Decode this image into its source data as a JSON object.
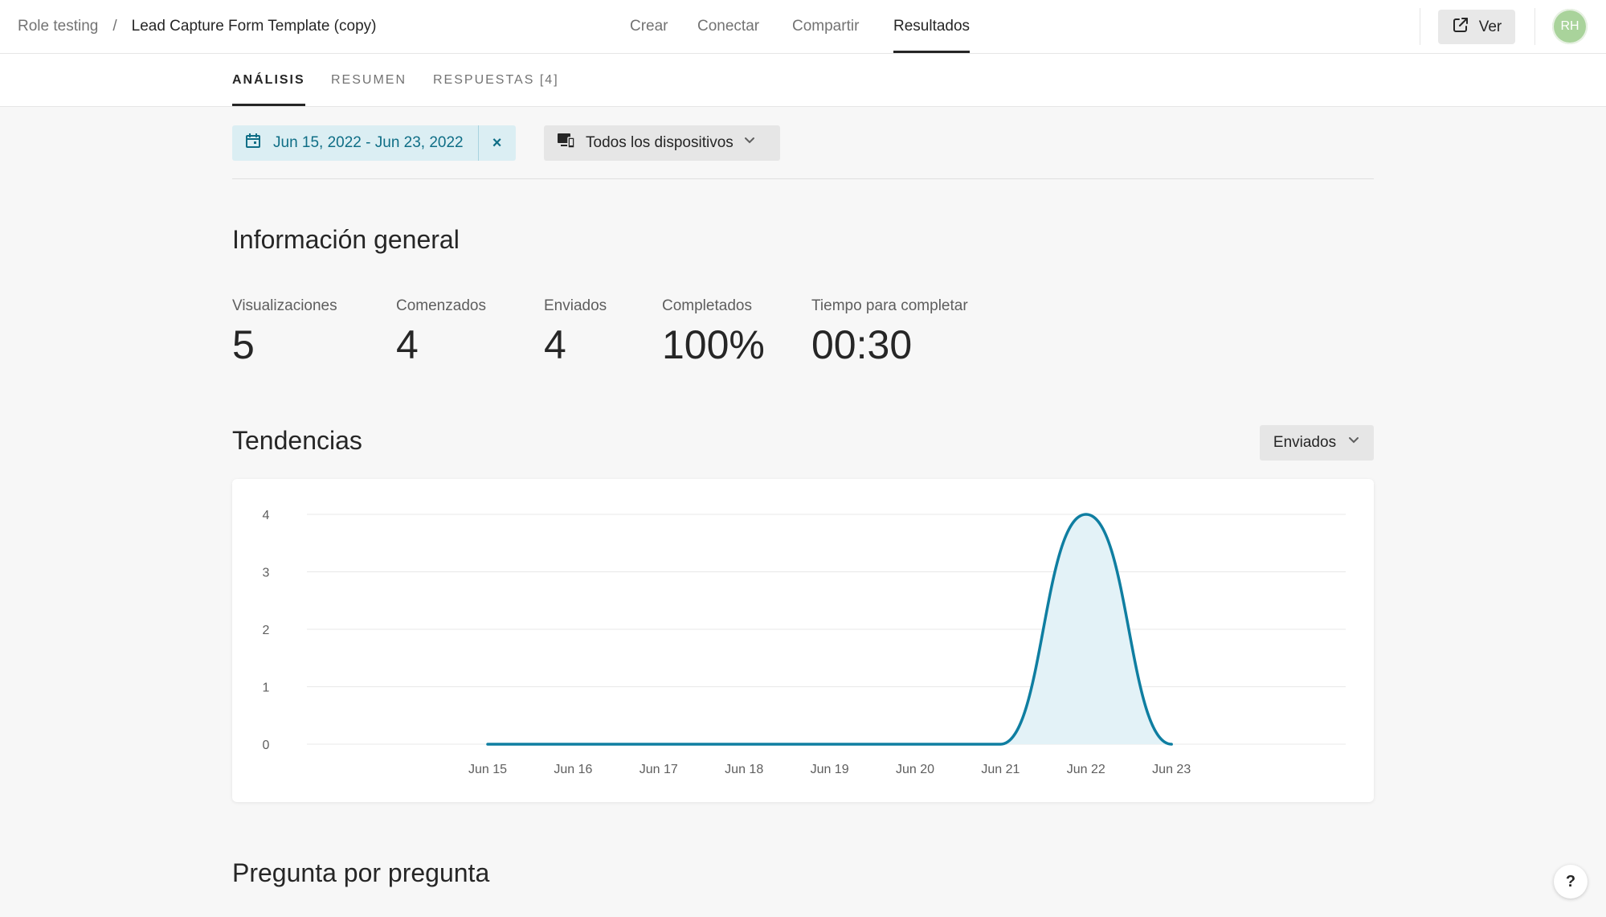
{
  "breadcrumb": {
    "workspace": "Role testing",
    "separator": "/",
    "form": "Lead Capture Form Template (copy)"
  },
  "top_nav": {
    "items": [
      "Crear",
      "Conectar",
      "Compartir",
      "Resultados"
    ],
    "active": "Resultados"
  },
  "header_actions": {
    "view_label": "Ver",
    "avatar_initials": "RH"
  },
  "subtabs": {
    "items": [
      "ANÁLISIS",
      "RESUMEN",
      "RESPUESTAS [4]"
    ],
    "active": "ANÁLISIS"
  },
  "filters": {
    "date_range": "Jun 15, 2022 - Jun 23, 2022",
    "clear_symbol": "×",
    "devices": "Todos los dispositivos"
  },
  "overview": {
    "title": "Información general",
    "stats": [
      {
        "label": "Visualizaciones",
        "value": "5"
      },
      {
        "label": "Comenzados",
        "value": "4"
      },
      {
        "label": "Enviados",
        "value": "4"
      },
      {
        "label": "Completados",
        "value": "100%"
      },
      {
        "label": "Tiempo para completar",
        "value": "00:30"
      }
    ]
  },
  "trends": {
    "title": "Tendencias",
    "metric": "Enviados"
  },
  "chart_data": {
    "type": "area",
    "x": [
      "Jun 15",
      "Jun 16",
      "Jun 17",
      "Jun 18",
      "Jun 19",
      "Jun 20",
      "Jun 21",
      "Jun 22",
      "Jun 23"
    ],
    "y_ticks": [
      "0",
      "1",
      "2",
      "3",
      "4"
    ],
    "series": [
      {
        "values": [
          0,
          0,
          0,
          0,
          0,
          0,
          0,
          4,
          0
        ]
      }
    ],
    "ylim": [
      0,
      4
    ],
    "grid": true,
    "line_color": "#0f7ea1",
    "fill_color": "#e3f2f7"
  },
  "question_section": {
    "title": "Pregunta por pregunta"
  },
  "help": {
    "label": "?"
  },
  "colors": {
    "accent": "#0f6e86",
    "date_bg": "#dbeef3"
  }
}
